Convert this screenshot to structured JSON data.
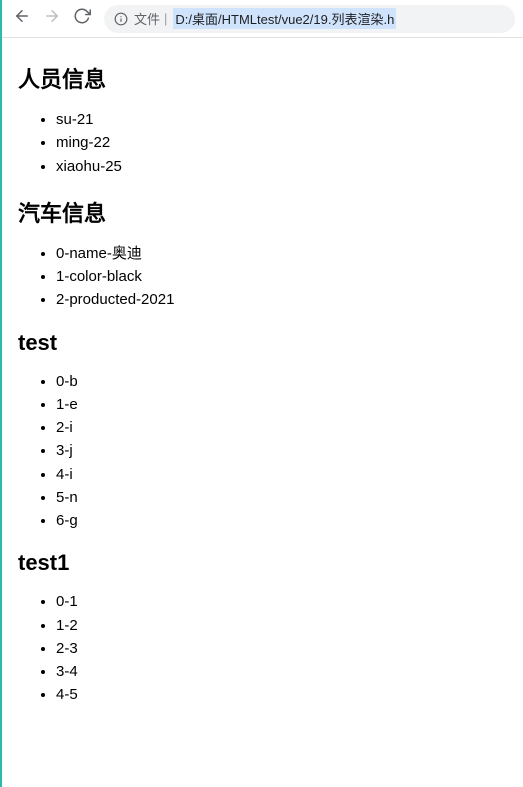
{
  "toolbar": {
    "file_label": "文件",
    "url": "D:/桌面/HTMLtest/vue2/19.列表渲染.h"
  },
  "sections": [
    {
      "heading": "人员信息",
      "items": [
        "su-21",
        "ming-22",
        "xiaohu-25"
      ]
    },
    {
      "heading": "汽车信息",
      "items": [
        "0-name-奥迪",
        "1-color-black",
        "2-producted-2021"
      ]
    },
    {
      "heading": "test",
      "items": [
        "0-b",
        "1-e",
        "2-i",
        "3-j",
        "4-i",
        "5-n",
        "6-g"
      ]
    },
    {
      "heading": "test1",
      "items": [
        "0-1",
        "1-2",
        "2-3",
        "3-4",
        "4-5"
      ]
    }
  ]
}
